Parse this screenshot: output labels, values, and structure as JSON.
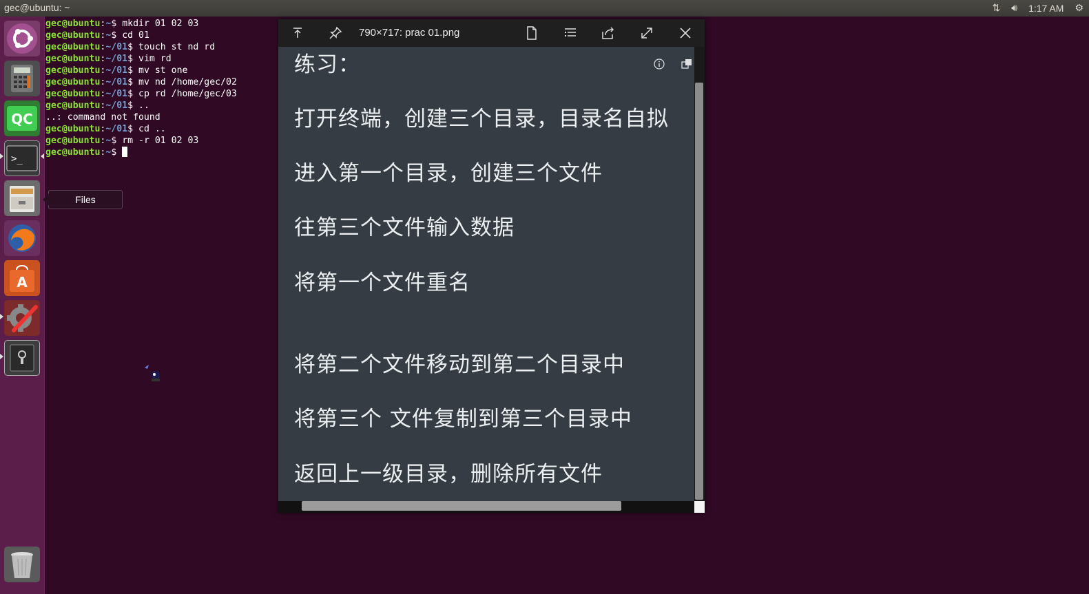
{
  "top_panel": {
    "title": "gec@ubuntu: ~",
    "time": "1:17 AM",
    "icons": [
      "network-arrows-icon",
      "volume-icon",
      "gear-icon"
    ]
  },
  "launcher": {
    "items": [
      {
        "name": "ubuntu-dash",
        "icon": "ubuntu-logo-icon"
      },
      {
        "name": "calculator",
        "icon": "calculator-icon"
      },
      {
        "name": "qt-creator",
        "icon": "qc-icon",
        "label": "QC"
      },
      {
        "name": "terminal",
        "icon": "terminal-icon",
        "label": ">_"
      },
      {
        "name": "files",
        "icon": "file-cabinet-icon"
      },
      {
        "name": "firefox",
        "icon": "firefox-icon"
      },
      {
        "name": "software-center",
        "icon": "shopping-bag-icon",
        "label": "A"
      },
      {
        "name": "system-settings",
        "icon": "wrench-gear-icon"
      },
      {
        "name": "disks",
        "icon": "disk-icon"
      },
      {
        "name": "trash",
        "icon": "trash-icon"
      }
    ],
    "tooltip": "Files"
  },
  "terminal": {
    "lines": [
      {
        "user": "gec@ubuntu",
        "path": "~",
        "cmd": " mkdir 01 02 03"
      },
      {
        "user": "gec@ubuntu",
        "path": "~",
        "cmd": " cd 01"
      },
      {
        "user": "gec@ubuntu",
        "path": "~/01",
        "cmd": " touch st nd rd"
      },
      {
        "user": "gec@ubuntu",
        "path": "~/01",
        "cmd": " vim rd"
      },
      {
        "user": "gec@ubuntu",
        "path": "~/01",
        "cmd": " mv st one"
      },
      {
        "user": "gec@ubuntu",
        "path": "~/01",
        "cmd": " mv nd /home/gec/02"
      },
      {
        "user": "gec@ubuntu",
        "path": "~/01",
        "cmd": " cp rd /home/gec/03"
      },
      {
        "user": "gec@ubuntu",
        "path": "~/01",
        "cmd": " .."
      },
      {
        "output": "..: command not found"
      },
      {
        "user": "gec@ubuntu",
        "path": "~/01",
        "cmd": " cd .."
      },
      {
        "user": "gec@ubuntu",
        "path": "~",
        "cmd": " rm -r 01 02 03"
      },
      {
        "user": "gec@ubuntu",
        "path": "~",
        "cmd": " ",
        "cursor": true
      }
    ]
  },
  "viewer": {
    "title": "790×717: prac 01.png",
    "toolbar_icons": [
      "upload-arrow-icon",
      "pin-icon",
      "document-icon",
      "list-icon",
      "share-icon",
      "expand-icon",
      "close-icon"
    ],
    "content_lines": [
      "练习：",
      "打开终端，创建三个目录，目录名自拟",
      "进入第一个目录，创建三个文件",
      "往第三个文件输入数据",
      "将第一个文件重名",
      "将第二个文件移动到第二个目录中",
      "将第三个  文件复制到第三个目录中",
      "返回上一级目录，删除所有文件"
    ]
  },
  "colors": {
    "desktop_bg": "#300a24",
    "launcher_bg": "#5b1e4a",
    "prompt_user": "#8ae234",
    "prompt_path": "#729fcf",
    "viewer_bg": "#353c43"
  }
}
